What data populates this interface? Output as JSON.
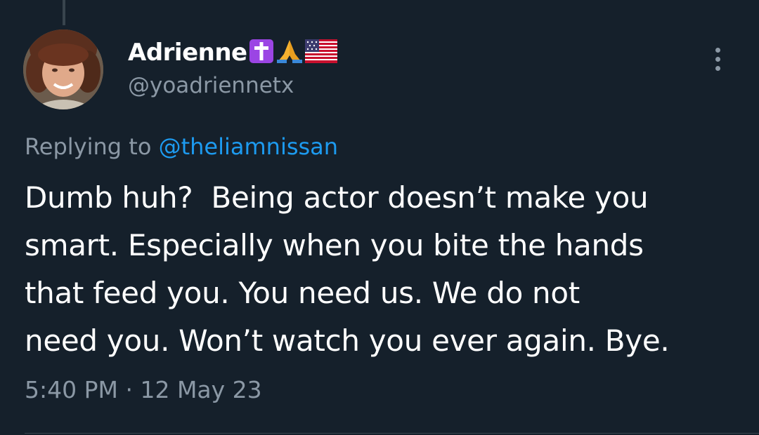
{
  "tweet": {
    "display_name": "Adrienne",
    "badges": [
      "latin-cross-icon",
      "praying-hands-icon",
      "us-flag-icon"
    ],
    "handle": "@yoadriennetx",
    "replying_prefix": "Replying to",
    "replying_handle": "@theliamnissan",
    "text": "Dumb huh?  Being actor doesn’t make you\nsmart. Especially when you bite the hands\nthat feed you. You need us. We do not\nneed you. Won’t watch you ever again. Bye.",
    "time": "5:40 PM",
    "separator": "·",
    "date": "12 May 23"
  },
  "colors": {
    "background": "#15202b",
    "text": "#ffffff",
    "secondary": "#8b98a5",
    "link": "#1d9bf0",
    "divider": "#38444d"
  }
}
